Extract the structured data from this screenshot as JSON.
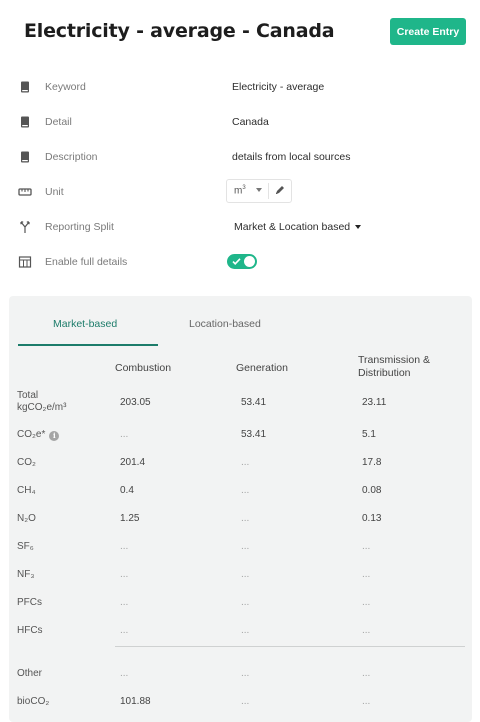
{
  "header": {
    "title": "Electricity - average - Canada",
    "create_button": "Create Entry"
  },
  "fields": {
    "keyword": {
      "label": "Keyword",
      "value": "Electricity - average",
      "icon": "book-icon"
    },
    "detail": {
      "label": "Detail",
      "value": "Canada",
      "icon": "book-icon"
    },
    "description": {
      "label": "Description",
      "value": "details from local sources",
      "icon": "book-icon"
    },
    "unit": {
      "label": "Unit",
      "value_base": "m",
      "value_sup": "3",
      "icon": "ruler-icon"
    },
    "reporting_split": {
      "label": "Reporting Split",
      "value": "Market & Location based",
      "icon": "split-icon"
    },
    "full_details": {
      "label": "Enable full details",
      "enabled": true,
      "icon": "table-icon"
    }
  },
  "tabs": {
    "market": "Market-based",
    "location": "Location-based",
    "active": "market"
  },
  "table": {
    "headers": {
      "combustion": "Combustion",
      "generation": "Generation",
      "td_line1": "Transmission &",
      "td_line2": "Distribution"
    },
    "rows": [
      {
        "label": "Total",
        "label2": "kgCO₂e/m³",
        "c1": "203.05",
        "c2": "53.41",
        "c3": "23.11"
      },
      {
        "label": "CO₂e*",
        "info": "i",
        "c1": "...",
        "c2": "53.41",
        "c3": "5.1"
      },
      {
        "label": "CO₂",
        "c1": "201.4",
        "c2": "...",
        "c3": "17.8"
      },
      {
        "label": "CH₄",
        "c1": "0.4",
        "c2": "...",
        "c3": "0.08"
      },
      {
        "label": "N₂O",
        "c1": "1.25",
        "c2": "...",
        "c3": "0.13"
      },
      {
        "label": "SF₆",
        "c1": "...",
        "c2": "...",
        "c3": "..."
      },
      {
        "label": "NF₃",
        "c1": "...",
        "c2": "...",
        "c3": "..."
      },
      {
        "label": "PFCs",
        "c1": "...",
        "c2": "...",
        "c3": "..."
      },
      {
        "label": "HFCs",
        "c1": "...",
        "c2": "...",
        "c3": "..."
      },
      {
        "label": "Other",
        "c1": "...",
        "c2": "...",
        "c3": "..."
      },
      {
        "label": "bioCO₂",
        "c1": "101.88",
        "c2": "...",
        "c3": "..."
      }
    ]
  },
  "colors": {
    "accent": "#1fb68a",
    "tab_active": "#1d7c6a",
    "panel_bg": "#f2f3f3"
  }
}
